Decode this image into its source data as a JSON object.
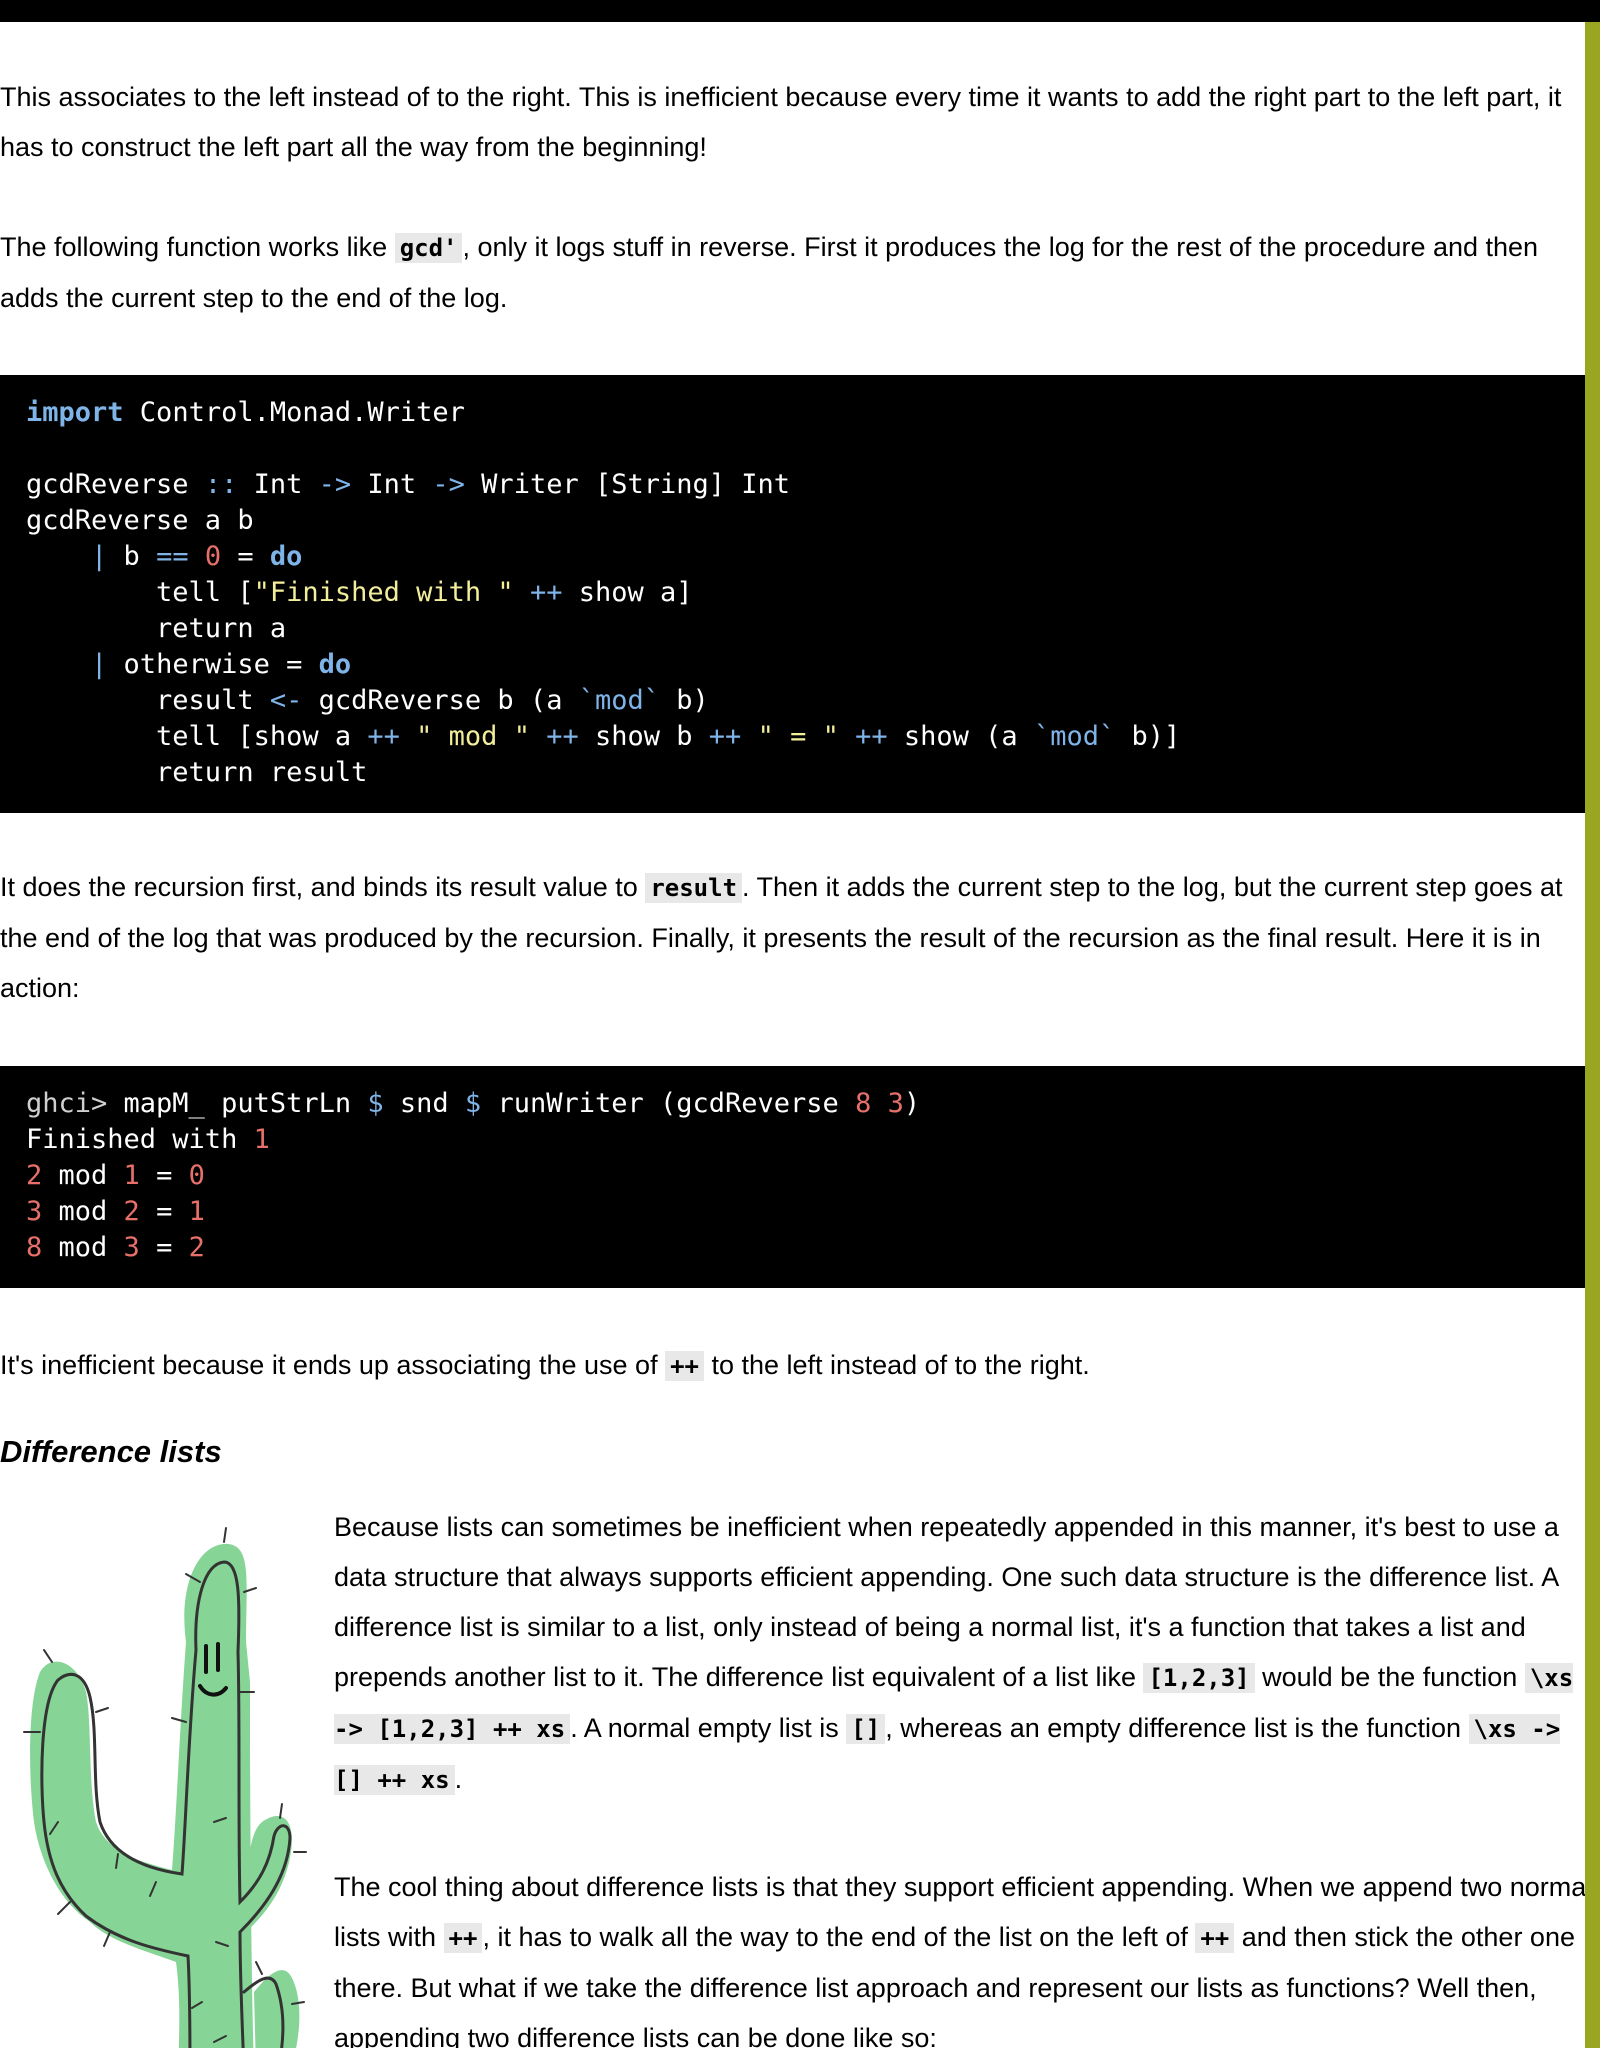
{
  "p1": "This associates to the left instead of to the right. This is inefficient because every time it wants to add the right part to the left part, it has to construct the left part all the way from the beginning!",
  "p2": {
    "t1": "The following function works like ",
    "code": "gcd'",
    "t2": ", only it logs stuff in reverse. First it produces the log for the rest of the procedure and then adds the current step to the end of the log."
  },
  "code1": {
    "l1_kw": "import",
    "l1_rest": " Control.Monad.Writer",
    "l2_a": "gcdReverse ",
    "l2_b": "::",
    "l2_c": " Int ",
    "l2_d": "->",
    "l2_e": " Int ",
    "l2_f": "->",
    "l2_g": " Writer [String] Int",
    "l3": "gcdReverse a b",
    "l4_a": "    ",
    "l4_b": "|",
    "l4_c": " b ",
    "l4_d": "==",
    "l4_e": " ",
    "l4_f": "0",
    "l4_g": " = ",
    "l4_h": "do",
    "l5_a": "        tell [",
    "l5_b": "\"Finished with \"",
    "l5_c": " ",
    "l5_d": "++",
    "l5_e": " show a]",
    "l6": "        return a",
    "l7_a": "    ",
    "l7_b": "|",
    "l7_c": " otherwise = ",
    "l7_d": "do",
    "l8_a": "        result ",
    "l8_b": "<-",
    "l8_c": " gcdReverse b (a ",
    "l8_d": "`mod`",
    "l8_e": " b)",
    "l9_a": "        tell [show a ",
    "l9_b": "++",
    "l9_c": " ",
    "l9_d": "\" mod \"",
    "l9_e": " ",
    "l9_f": "++",
    "l9_g": " show b ",
    "l9_h": "++",
    "l9_i": " ",
    "l9_j": "\" = \"",
    "l9_k": " ",
    "l9_l": "++",
    "l9_m": " show (a ",
    "l9_n": "`mod`",
    "l9_o": " b)]",
    "l10": "        return result"
  },
  "p3": {
    "t1": "It does the recursion first, and binds its result value to ",
    "code": "result",
    "t2": ". Then it adds the current step to the log, but the current step goes at the end of the log that was produced by the recursion. Finally, it presents the result of the recursion as the final result. Here it is in action:"
  },
  "code2": {
    "l1_prompt": "ghci>",
    "l1_a": " mapM_ putStrLn ",
    "l1_b": "$",
    "l1_c": " snd ",
    "l1_d": "$",
    "l1_e": " runWriter (gcdReverse ",
    "l1_f": "8",
    "l1_g": " ",
    "l1_h": "3",
    "l1_i": ")",
    "l2_a": "Finished with ",
    "l2_b": "1",
    "l3_a": "2",
    "l3_b": " mod ",
    "l3_c": "1",
    "l3_d": " = ",
    "l3_e": "0",
    "l4_a": "3",
    "l4_b": " mod ",
    "l4_c": "2",
    "l4_d": " = ",
    "l4_e": "1",
    "l5_a": "8",
    "l5_b": " mod ",
    "l5_c": "3",
    "l5_d": " = ",
    "l5_e": "2"
  },
  "p4": {
    "t1": "It's inefficient because it ends up associating the use of ",
    "code": "++",
    "t2": " to the left instead of to the right."
  },
  "heading": "Difference lists",
  "p5": {
    "t1": "Because lists can sometimes be inefficient when repeatedly appended in this manner, it's best to use a data structure that always supports efficient appending. One such data structure is the difference list. A difference list is similar to a list, only instead of being a normal list, it's a function that takes a list and prepends another list to it. The difference list equivalent of a list like ",
    "c1": "[1,2,3]",
    "t2": " would be the function ",
    "c2": "\\xs -> [1,2,3] ++ xs",
    "t3": ". A normal empty list is ",
    "c3": "[]",
    "t4": ", whereas an empty difference list is the function ",
    "c4": "\\xs -> [] ++ xs",
    "t5": "."
  },
  "p6": {
    "t1": "The cool thing about difference lists is that they support efficient appending. When we append two normal lists with ",
    "c1": "++",
    "t2": ", it has to walk all the way to the end of the list on the left of ",
    "c2": "++",
    "t3": " and then stick the other one there. But what if we take the difference list approach and represent our lists as functions? Well then, appending two difference lists can be done like so:"
  }
}
